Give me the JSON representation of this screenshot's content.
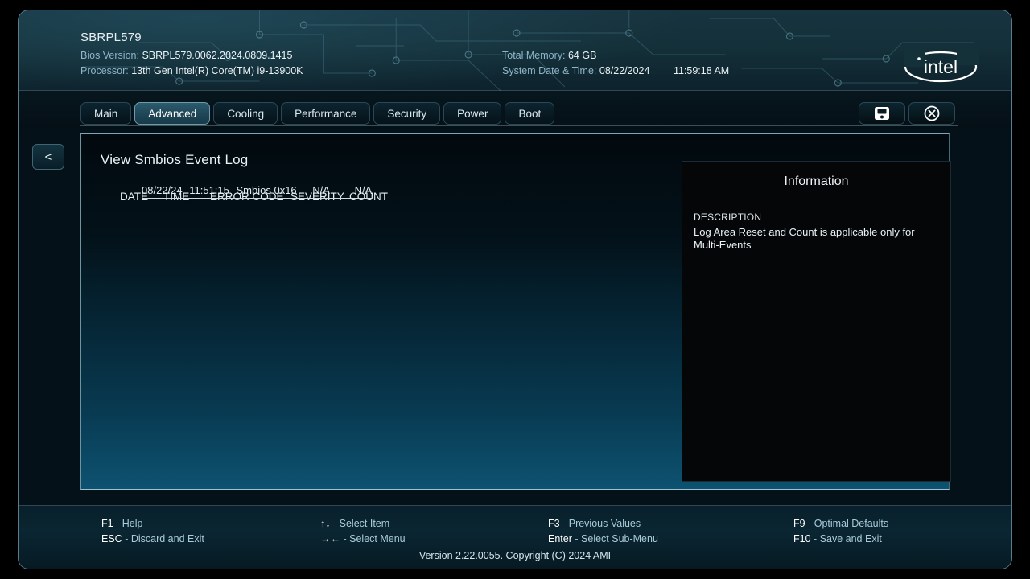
{
  "header": {
    "system_name": "SBRPL579",
    "bios_version_label": "Bios Version:",
    "bios_version_value": "SBRPL579.0062.2024.0809.1415",
    "processor_label": "Processor:",
    "processor_value": "13th Gen Intel(R) Core(TM) i9-13900K",
    "total_memory_label": "Total Memory:",
    "total_memory_value": "64 GB",
    "datetime_label": "System Date & Time:",
    "date_value": "08/22/2024",
    "time_value": "11:59:18 AM",
    "logo_text": "intel",
    "logo_name": "intel-logo"
  },
  "tabs": [
    {
      "label": "Main",
      "active": false
    },
    {
      "label": "Advanced",
      "active": true
    },
    {
      "label": "Cooling",
      "active": false
    },
    {
      "label": "Performance",
      "active": false
    },
    {
      "label": "Security",
      "active": false
    },
    {
      "label": "Power",
      "active": false
    },
    {
      "label": "Boot",
      "active": false
    }
  ],
  "window_buttons": [
    {
      "name": "save-button",
      "icon": "save-floppy-icon"
    },
    {
      "name": "close-button",
      "icon": "close-circle-x-icon"
    }
  ],
  "back_button": {
    "label": "<",
    "icon": "chevron-left-icon"
  },
  "main": {
    "panel_title": "View Smbios Event Log",
    "table": {
      "columns": [
        "DATE",
        "TIME",
        "ERROR CODE",
        "SEVERITY",
        "COUNT"
      ],
      "rows": [
        {
          "date": "08/22/24",
          "time": "11:51:15",
          "error_code": "Smbios 0x16",
          "severity": "N/A",
          "count": "N/A",
          "selected": true
        }
      ]
    }
  },
  "information": {
    "title": "Information",
    "description_label": "DESCRIPTION",
    "description_text": "Log Area Reset and Count is applicable only for Multi-Events"
  },
  "footer": {
    "hotkeys": [
      {
        "key": "F1",
        "sep": "-",
        "desc": "Help"
      },
      {
        "key": "ESC",
        "sep": "-",
        "desc": "Discard and Exit"
      },
      {
        "key": "↑↓",
        "sep": "-",
        "desc": "Select Item"
      },
      {
        "key": "→←",
        "sep": "-",
        "desc": "Select Menu"
      },
      {
        "key": "F3",
        "sep": "-",
        "desc": "Previous Values"
      },
      {
        "key": "Enter",
        "sep": "-",
        "desc": "Select Sub-Menu"
      },
      {
        "key": "F9",
        "sep": "-",
        "desc": "Optimal Defaults"
      },
      {
        "key": "F10",
        "sep": "-",
        "desc": "Save and Exit"
      }
    ],
    "version_line": "Version 2.22.0055. Copyright (C) 2024 AMI"
  },
  "colors": {
    "accent_teal": "#0d5271",
    "header_blue": "#143039",
    "text_primary": "#eaf2f6",
    "text_label": "#8fb6c9",
    "active_tab": "#2c5c6e"
  }
}
